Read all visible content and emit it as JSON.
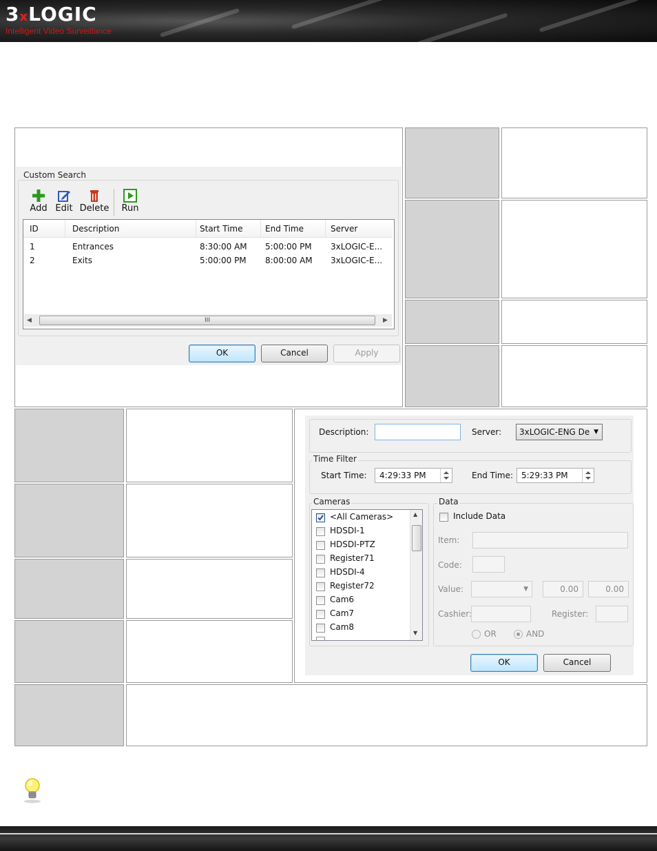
{
  "header": {
    "logo_main": "3",
    "logo_x": "x",
    "logo_rest": "LOGIC",
    "tagline": "Intelligent Video Surveillance"
  },
  "custom_search_dialog": {
    "group_title": "Custom Search",
    "toolbar": [
      {
        "label": "Add",
        "icon": "plus-icon",
        "color": "#2a9a1a"
      },
      {
        "label": "Edit",
        "icon": "edit-icon",
        "color": "#2b5bc7"
      },
      {
        "label": "Delete",
        "icon": "trash-icon",
        "color": "#c73a1a"
      },
      {
        "label": "Run",
        "icon": "play-icon",
        "color": "#2a9a1a"
      }
    ],
    "columns": [
      "ID",
      "Description",
      "Start Time",
      "End Time",
      "Server"
    ],
    "rows": [
      {
        "id": "1",
        "description": "Entrances",
        "start": "8:30:00 AM",
        "end": "5:00:00 PM",
        "server": "3xLOGIC-E..."
      },
      {
        "id": "2",
        "description": "Exits",
        "start": "5:00:00 PM",
        "end": "8:00:00 AM",
        "server": "3xLOGIC-E..."
      }
    ],
    "scroll_thumb_glyph": "III",
    "ok": "OK",
    "cancel": "Cancel",
    "apply": "Apply"
  },
  "search_editor_dialog": {
    "description_label": "Description:",
    "description_value": "",
    "server_label": "Server:",
    "server_value": "3xLOGIC-ENG De",
    "time_filter_title": "Time Filter",
    "start_label": "Start Time:",
    "start_value": "4:29:33 PM",
    "end_label": "End Time:",
    "end_value": "5:29:33 PM",
    "cameras_title": "Cameras",
    "cameras": [
      {
        "name": "<All Cameras>",
        "checked": true
      },
      {
        "name": "HDSDI-1",
        "checked": false
      },
      {
        "name": "HDSDI-PTZ",
        "checked": false
      },
      {
        "name": "Register71",
        "checked": false
      },
      {
        "name": "HDSDI-4",
        "checked": false
      },
      {
        "name": "Register72",
        "checked": false
      },
      {
        "name": "Cam6",
        "checked": false
      },
      {
        "name": "Cam7",
        "checked": false
      },
      {
        "name": "Cam8",
        "checked": false
      }
    ],
    "data_title": "Data",
    "include_data_label": "Include Data",
    "item_label": "Item:",
    "code_label": "Code:",
    "value_label": "Value:",
    "value_min": "0.00",
    "value_max": "0.00",
    "cashier_label": "Cashier:",
    "register_label": "Register:",
    "or_label": "OR",
    "and_label": "AND",
    "ok": "OK",
    "cancel": "Cancel"
  }
}
